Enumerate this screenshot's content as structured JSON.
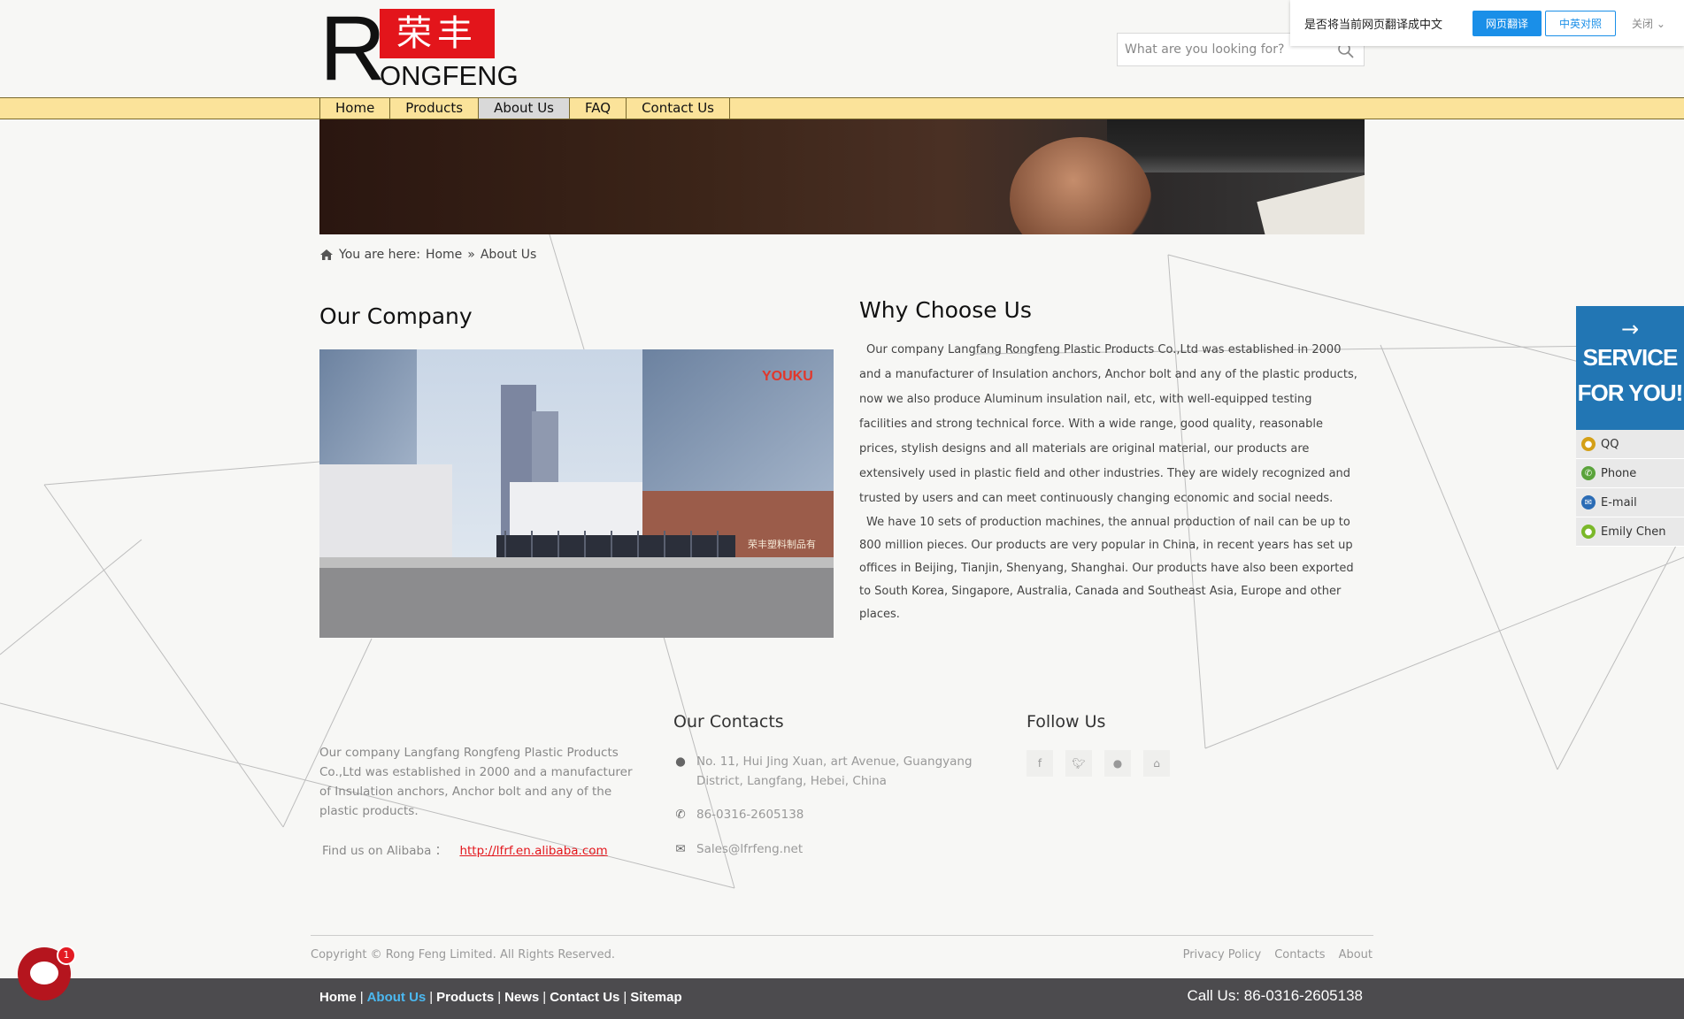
{
  "translate_bar": {
    "question": "是否将当前网页翻译成中文",
    "translate_btn": "网页翻译",
    "bilingual_btn": "中英对照",
    "close_label": "关闭"
  },
  "logo": {
    "big_letter": "R",
    "chinese": "荣丰",
    "text": "ONGFENG"
  },
  "search": {
    "placeholder": "What are you looking for?"
  },
  "nav": {
    "items": [
      "Home",
      "Products",
      "About Us",
      "FAQ",
      "Contact Us"
    ],
    "active": "About Us"
  },
  "breadcrumb": {
    "prefix": "You are here:",
    "home": "Home",
    "sep": "»",
    "current": "About Us"
  },
  "company": {
    "title": "Our Company",
    "photo_watermark": "YOUKU",
    "gate_sign": "荣丰塑料制品有"
  },
  "why": {
    "title": "Why Choose Us",
    "paragraph1": "Our company Langfang Rongfeng Plastic Products Co.,Ltd was established in 2000 and a manufacturer of Insulation anchors, Anchor bolt and any of the plastic products, now we also produce Aluminum insulation nail, etc, with well-equipped testing facilities and strong technical force. With a wide range, good quality, reasonable prices, stylish designs and all materials are original material, our products are extensively used in plastic field and other industries. They are widely recognized and trusted by users and can meet continuously changing economic and social needs.",
    "paragraph2": "We have 10 sets of production machines, the annual production of nail can be up to 800 million pieces. Our products are very popular in China, in recent years has set up offices in Beijing, Tianjin, Shenyang, Shanghai. Our products have also been exported to South Korea, Singapore, Australia, Canada and Southeast Asia, Europe and other places."
  },
  "footer": {
    "about_text": "Our company Langfang Rongfeng Plastic Products Co.,Ltd was established in 2000 and a manufacturer of Insulation anchors, Anchor bolt and any of the plastic products.",
    "alibaba_label": "Find us on Alibaba ：",
    "alibaba_link": "http://lfrf.en.alibaba.com",
    "contacts_title": "Our Contacts",
    "address": "No. 11, Hui Jing Xuan, art Avenue, Guangyang District, Langfang, Hebei, China",
    "phone": "86-0316-2605138",
    "email": "Sales@lfrfeng.net",
    "follow_title": "Follow Us",
    "social_icons": [
      "facebook-icon",
      "twitter-icon",
      "qq-icon",
      "home-icon"
    ],
    "copyright": "Copyright © Rong Feng Limited. All Rights Reserved.",
    "links": [
      "Privacy Policy",
      "Contacts",
      "About"
    ]
  },
  "bottom_bar": {
    "links": [
      "Home",
      "About Us",
      "Products",
      "News",
      "Contact Us",
      "Sitemap"
    ],
    "highlight": "About Us",
    "sep": "|",
    "call": "Call Us: 86-0316-2605138"
  },
  "service_panel": {
    "line1": "SERVICE",
    "line2": "FOR YOU!",
    "items": [
      {
        "label": "QQ",
        "color": "#d4a017"
      },
      {
        "label": "Phone",
        "color": "#5aa33b"
      },
      {
        "label": "E-mail",
        "color": "#2b6cb5"
      },
      {
        "label": "Emily Chen",
        "color": "#7ab829"
      }
    ]
  },
  "chat": {
    "badge": "1"
  },
  "colors": {
    "nav_bg": "#fbe39a",
    "brand_red": "#e3151b",
    "service_blue": "#2276b4",
    "bottom_bar": "#4c4b4e",
    "link_blue": "#4bb8f0"
  }
}
